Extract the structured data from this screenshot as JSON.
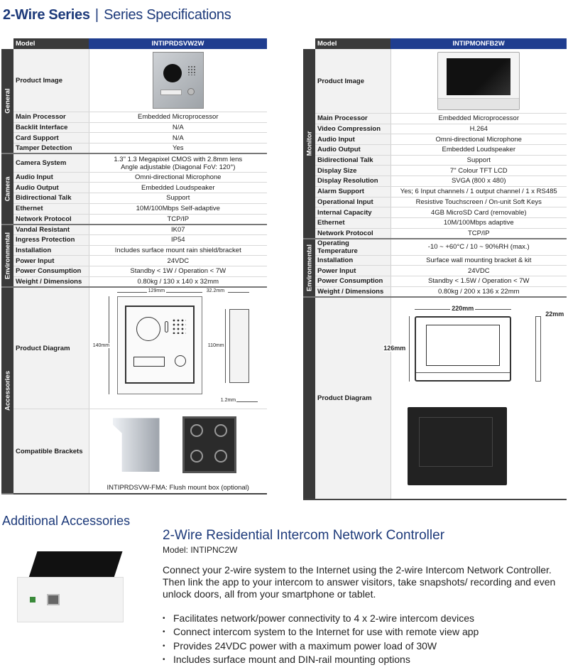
{
  "header": {
    "title_bold": "2-Wire Series",
    "separator": "|",
    "title_light": "Series Specifications"
  },
  "left_table": {
    "model_label": "Model",
    "model_value": "INTIPRDSVW2W",
    "groups": [
      {
        "category": "General",
        "rows": [
          {
            "label": "Product Image",
            "value": ""
          },
          {
            "label": "Main Processor",
            "value": "Embedded Microprocessor"
          },
          {
            "label": "Backlit Interface",
            "value": "N/A"
          },
          {
            "label": "Card Support",
            "value": "N/A"
          },
          {
            "label": "Tamper Detection",
            "value": "Yes"
          }
        ]
      },
      {
        "category": "Camera",
        "rows": [
          {
            "label": "Camera System",
            "value": "1.3\" 1.3 Megapixel CMOS with 2.8mm lens",
            "value2": "Angle adjustable (Diagonal FoV: 120°)"
          },
          {
            "label": "Audio Input",
            "value": "Omni-directional Microphone"
          },
          {
            "label": "Audio Output",
            "value": "Embedded Loudspeaker"
          },
          {
            "label": "Bidirectional Talk",
            "value": "Support"
          },
          {
            "label": "Ethernet",
            "value": "10M/100Mbps Self-adaptive"
          },
          {
            "label": "Network Protocol",
            "value": "TCP/IP"
          }
        ]
      },
      {
        "category": "Environmental",
        "rows": [
          {
            "label": "Vandal Resistant",
            "value": "IK07"
          },
          {
            "label": "Ingress Protection",
            "value": "IP54"
          },
          {
            "label": "Installation",
            "value": "Includes surface mount rain shield/bracket"
          },
          {
            "label": "Power Input",
            "value": "24VDC"
          },
          {
            "label": "Power Consumption",
            "value": "Standby < 1W / Operation < 7W"
          },
          {
            "label": "Weight / Dimensions",
            "value": "0.80kg / 130 x 140 x 32mm"
          }
        ]
      },
      {
        "category": "Accessories",
        "rows": [
          {
            "label": "Product Diagram",
            "value": ""
          },
          {
            "label": "Compatible Brackets",
            "value": "INTIPRDSVW-FMA: Flush mount box (optional)"
          }
        ]
      }
    ],
    "diagram_dims": {
      "width": "129mm",
      "height": "140mm",
      "depth": "32.2mm",
      "inner_height": "110mm",
      "thickness": "1.2mm"
    }
  },
  "right_table": {
    "model_label": "Model",
    "model_value": "INTIPMONFB2W",
    "groups": [
      {
        "category": "Monitor",
        "rows": [
          {
            "label": "Product Image",
            "value": ""
          },
          {
            "label": "Main Processor",
            "value": "Embedded Microprocessor"
          },
          {
            "label": "Video Compression",
            "value": "H.264"
          },
          {
            "label": "Audio Input",
            "value": "Omni-directional Microphone"
          },
          {
            "label": "Audio Output",
            "value": "Embedded Loudspeaker"
          },
          {
            "label": "Bidirectional Talk",
            "value": "Support"
          },
          {
            "label": "Display Size",
            "value": "7\" Colour TFT LCD"
          },
          {
            "label": "Display Resolution",
            "value": "SVGA (800 x 480)"
          },
          {
            "label": "Alarm Support",
            "value": "Yes; 6 Input channels / 1 output channel / 1 x RS485"
          },
          {
            "label": "Operational Input",
            "value": "Resistive Touchscreen / On-unit Soft Keys"
          },
          {
            "label": "Internal Capacity",
            "value": "4GB MicroSD Card (removable)"
          },
          {
            "label": "Ethernet",
            "value": "10M/100Mbps adaptive"
          },
          {
            "label": "Network Protocol",
            "value": "TCP/IP"
          }
        ]
      },
      {
        "category": "Environmental",
        "rows": [
          {
            "label": "Operating Temperature",
            "value": "-10 ~ +60°C / 10 ~ 90%RH (max.)"
          },
          {
            "label": "Installation",
            "value": "Surface wall mounting bracket & kit"
          },
          {
            "label": "Power Input",
            "value": "24VDC"
          },
          {
            "label": "Power Consumption",
            "value": "Standby < 1.5W / Operation < 7W"
          },
          {
            "label": "Weight / Dimensions",
            "value": "0.80kg / 200 x 136 x 22mm"
          }
        ]
      },
      {
        "category": "",
        "rows": [
          {
            "label": "Product Diagram",
            "value": ""
          }
        ]
      }
    ],
    "diagram_dims": {
      "width": "220mm",
      "height": "126mm",
      "depth": "22mm"
    }
  },
  "accessories": {
    "section_title": "Additional Accessories",
    "product_title": "2-Wire Residential Intercom Network Controller",
    "model": "Model: INTIPNC2W",
    "description": "Connect your 2-wire system to the Internet using the 2-wire Intercom Network Controller. Then link the app to your intercom to answer visitors, take snapshots/ recording and even unlock doors, all from your smartphone or tablet.",
    "bullets": [
      "Facilitates network/power connectivity to 4 x 2-wire intercom devices",
      "Connect intercom system to the Internet for use with remote view app",
      "Provides 24VDC power with a maximum power load of 30W",
      "Includes surface mount and DIN-rail mounting options"
    ]
  },
  "colors": {
    "brand_blue": "#1d3a7a",
    "header_blue": "#1f3d8f",
    "category_dark": "#3a3a3a"
  }
}
